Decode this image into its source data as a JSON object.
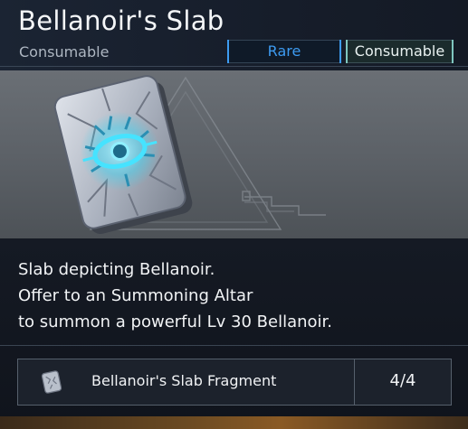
{
  "item": {
    "name": "Bellanoir's Slab",
    "category": "Consumable"
  },
  "tags": {
    "rarity": "Rare",
    "type": "Consumable"
  },
  "description": {
    "line1": "Slab depicting Bellanoir.",
    "line2": "Offer to an Summoning Altar",
    "line3": "to summon a powerful Lv 30 Bellanoir."
  },
  "material": {
    "name": "Bellanoir's Slab Fragment",
    "count": "4/4",
    "icon": "slab-fragment-icon"
  },
  "colors": {
    "rare": "#3d9bf1",
    "consumable_border": "#7fc6bf",
    "rune_glow": "#38d6f5"
  }
}
